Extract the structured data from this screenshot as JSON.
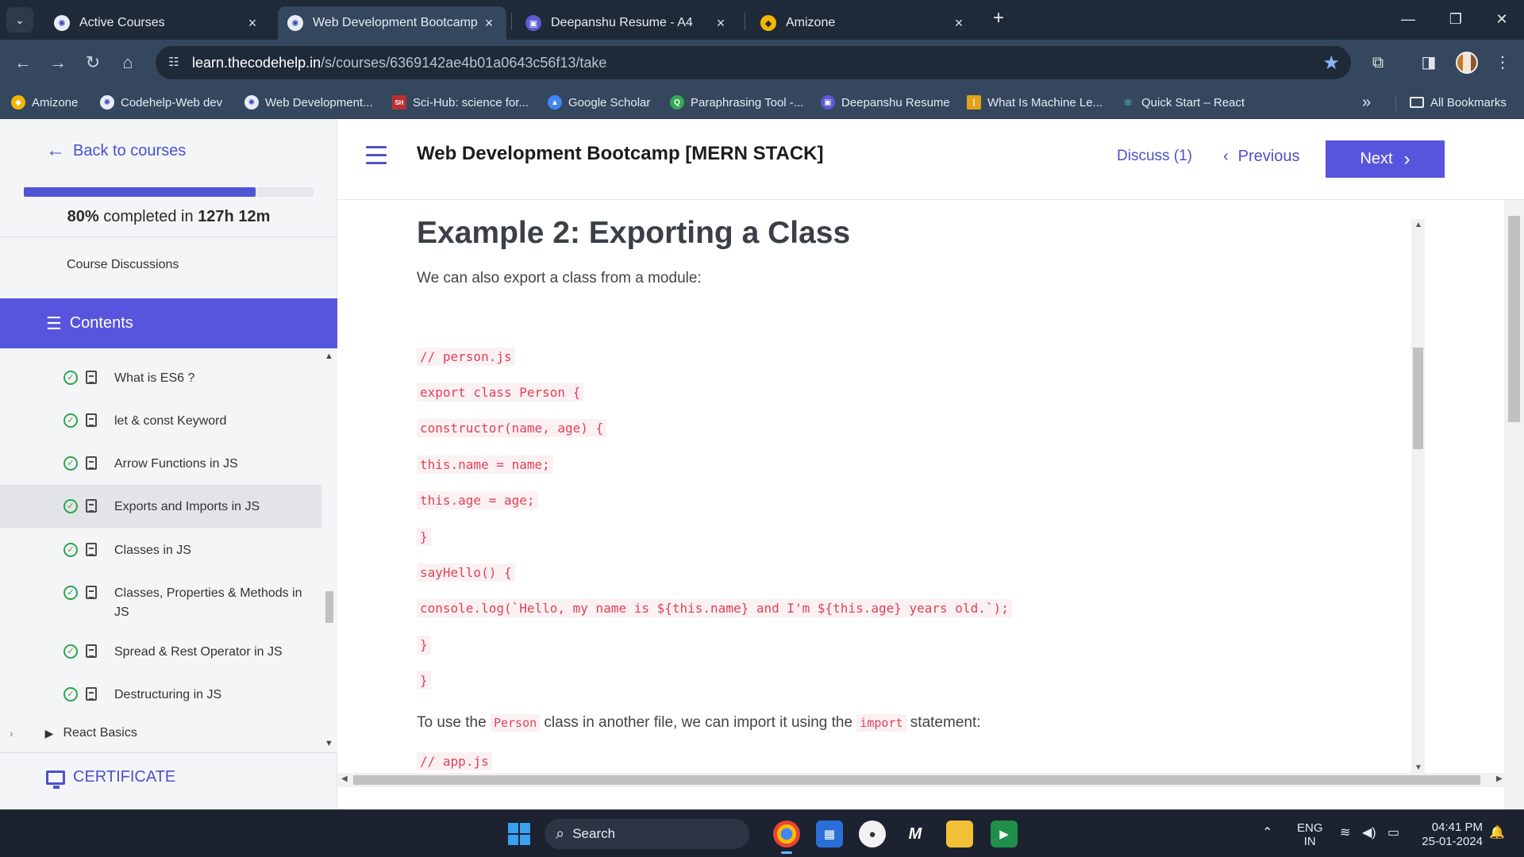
{
  "browser": {
    "tabs": [
      {
        "title": "Active Courses",
        "favicon": "codehelp-icon"
      },
      {
        "title": "Web Development Bootcamp [MERN STACK]",
        "favicon": "codehelp-icon"
      },
      {
        "title": "Deepanshu Resume - A4",
        "favicon": "resume-icon"
      },
      {
        "title": "Amizone",
        "favicon": "amizone-icon"
      }
    ],
    "url_host": "learn.thecodehelp.in",
    "url_path": "/s/courses/6369142ae4b01a0643c56f13/take",
    "bookmarks": [
      {
        "label": "Amizone",
        "color": "#f2b705"
      },
      {
        "label": "Codehelp-Web dev",
        "color": "#6b7cff"
      },
      {
        "label": "Web Development...",
        "color": "#6b7cff"
      },
      {
        "label": "Sci-Hub: science for...",
        "color": "#b8312f"
      },
      {
        "label": "Google Scholar",
        "color": "#4285f4"
      },
      {
        "label": "Paraphrasing Tool -...",
        "color": "#34a853"
      },
      {
        "label": "Deepanshu Resume",
        "color": "#5b5bd6"
      },
      {
        "label": "What Is Machine Le...",
        "color": "#e3a21a"
      },
      {
        "label": "Quick Start – React",
        "color": "#61dafb"
      }
    ],
    "all_bookmarks": "All Bookmarks"
  },
  "sidebar": {
    "back_label": "Back to courses",
    "progress_fraction": 0.8,
    "progress_percent": "80%",
    "progress_mid": " completed in ",
    "progress_time": "127h 12m",
    "course_discussions": "Course Discussions",
    "contents_label": "Contents",
    "lessons": [
      {
        "title": "What is ES6 ?",
        "completed": true
      },
      {
        "title": "let & const Keyword",
        "completed": true
      },
      {
        "title": "Arrow Functions in JS",
        "completed": true
      },
      {
        "title": "Exports and Imports in JS",
        "completed": true,
        "selected": true
      },
      {
        "title": "Classes in JS",
        "completed": true
      },
      {
        "title": "Classes, Properties & Methods in JS",
        "completed": true
      },
      {
        "title": "Spread & Rest Operator in JS",
        "completed": true
      },
      {
        "title": "Destructuring in JS",
        "completed": true
      }
    ],
    "next_section": "React Basics",
    "certificate_label": "CERTIFICATE"
  },
  "header": {
    "course_title": "Web Development Bootcamp [MERN STACK]",
    "discuss_label": "Discuss (1)",
    "previous_label": "Previous",
    "next_label": "Next"
  },
  "content": {
    "heading": "Example 2: Exporting a Class",
    "intro": "We can also export a class from a module:",
    "code_lines": [
      "// person.js",
      "export class Person {",
      "constructor(name, age) {",
      "this.name = name;",
      "this.age = age;",
      "}",
      "sayHello() {",
      "console.log(`Hello, my name is ${this.name} and I'm ${this.age} years old.`);",
      "}",
      "}"
    ],
    "para2_a": "To use the ",
    "para2_code1": "Person",
    "para2_b": " class in another file, we can import it using the ",
    "para2_code2": "import",
    "para2_c": " statement:",
    "code_line_2": "// app.js"
  },
  "taskbar": {
    "search_label": "Search",
    "lang_top": "ENG",
    "lang_bottom": "IN",
    "time": "04:41 PM",
    "date": "25-01-2024"
  }
}
